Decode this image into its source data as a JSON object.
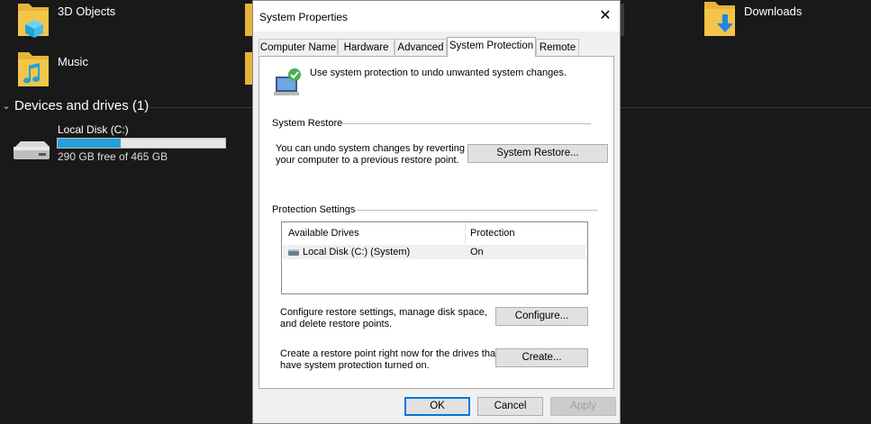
{
  "explorer": {
    "folders": [
      {
        "label": "3D Objects",
        "icon": "3d-objects-folder-icon"
      },
      {
        "label": "Music",
        "icon": "music-folder-icon"
      },
      {
        "label": "Downloads",
        "icon": "downloads-folder-icon"
      }
    ],
    "devices_section": "Devices and drives (1)",
    "drive": {
      "name": "Local Disk (C:)",
      "free_text": "290 GB free of 465 GB",
      "used_fraction": 0.376
    }
  },
  "dialog": {
    "title": "System Properties",
    "tabs": [
      "Computer Name",
      "Hardware",
      "Advanced",
      "System Protection",
      "Remote"
    ],
    "active_tab": "System Protection",
    "intro": "Use system protection to undo unwanted system changes.",
    "system_restore": {
      "heading": "System Restore",
      "description_line1": "You can undo system changes by reverting",
      "description_line2": "your computer to a previous restore point.",
      "button": "System Restore..."
    },
    "protection": {
      "heading": "Protection Settings",
      "columns": [
        "Available Drives",
        "Protection"
      ],
      "rows": [
        {
          "drive": "Local Disk (C:) (System)",
          "protection": "On"
        }
      ],
      "configure_text_line1": "Configure restore settings, manage disk space,",
      "configure_text_line2": "and delete restore points.",
      "configure_button": "Configure...",
      "create_text_line1": "Create a restore point right now for the drives that",
      "create_text_line2": "have system protection turned on.",
      "create_button": "Create..."
    },
    "buttons": {
      "ok": "OK",
      "cancel": "Cancel",
      "apply": "Apply"
    }
  },
  "colors": {
    "accent": "#0078d7",
    "folder": "#f3c54a",
    "disk_bar": "#26a0da"
  }
}
